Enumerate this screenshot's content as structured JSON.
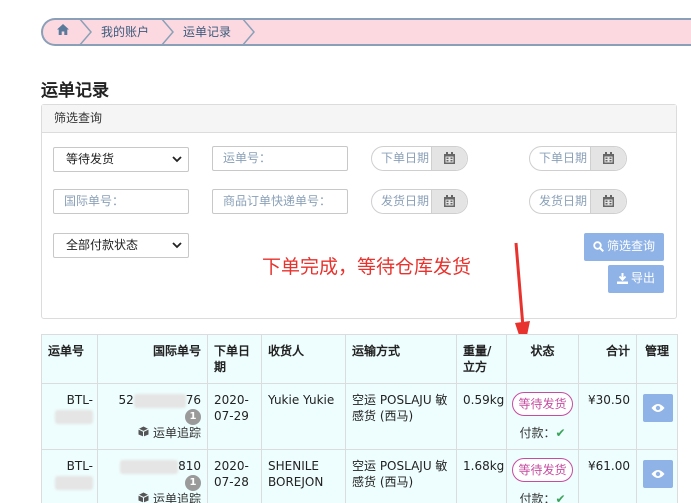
{
  "breadcrumb": {
    "home_icon": "home-icon",
    "items": [
      "我的账户",
      "运单记录"
    ]
  },
  "page_title": "运单记录",
  "filter": {
    "heading": "筛选查询",
    "status_select": "等待发货",
    "waybill_placeholder": "运单号：",
    "order_date_start": "下单日期",
    "order_date_end": "下单日期",
    "intl_placeholder": "国际单号：",
    "express_placeholder": "商品订单快递单号：",
    "ship_date_start": "发货日期",
    "ship_date_end": "发货日期",
    "payment_select": "全部付款状态",
    "search_button": "筛选查询",
    "export_button": "导出"
  },
  "annotation": "下单完成，等待仓库发货",
  "table": {
    "headers": [
      "运单号",
      "国际单号",
      "下单日期",
      "收货人",
      "运输方式",
      "重量/立方",
      "状态",
      "合计",
      "管理"
    ],
    "rows": [
      {
        "waybill": "BTL-",
        "intl_prefix": "52",
        "intl_suffix": "76",
        "count": "1",
        "track": "运单追踪",
        "date": "2020-07-29",
        "receiver": "Yukie Yukie",
        "shipping": "空运 POSLAJU 敏感货 (西马)",
        "weight": "0.59kg",
        "status": "等待发货",
        "paid_label": "付款：",
        "total": "¥30.50"
      },
      {
        "waybill": "BTL-",
        "intl_prefix": "",
        "intl_suffix": "810",
        "count": "1",
        "track": "运单追踪",
        "date": "2020-07-28",
        "receiver": "SHENILE BOREJON",
        "shipping": "空运 POSLAJU 敏感货 (西马)",
        "weight": "1.68kg",
        "status": "等待发货",
        "paid_label": "付款：",
        "total": "¥61.00"
      }
    ]
  },
  "colors": {
    "breadcrumb_bg": "#fcd9e0",
    "accent_blue": "#8fb3e6",
    "status_magenta": "#c54ca0",
    "annotation_red": "#e8322d",
    "table_bg": "#eefdfd"
  }
}
